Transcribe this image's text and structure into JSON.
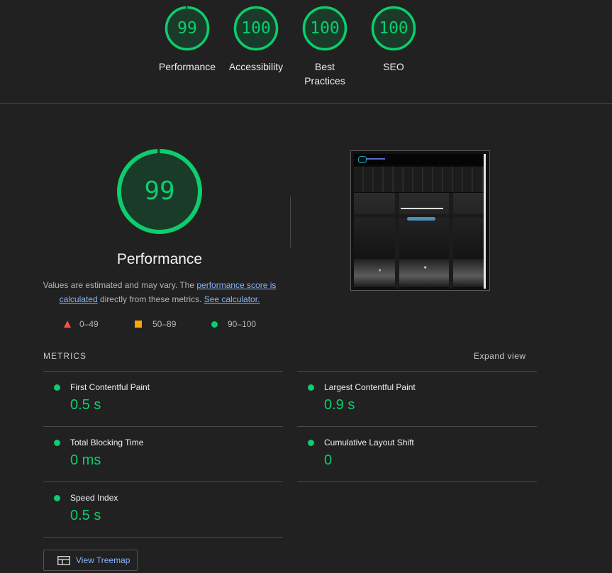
{
  "summary_gauges": [
    {
      "score": "99",
      "label": "Performance"
    },
    {
      "score": "100",
      "label": "Accessibility"
    },
    {
      "score": "100",
      "label": "Best Practices"
    },
    {
      "score": "100",
      "label": "SEO"
    }
  ],
  "performance": {
    "score": "99",
    "title": "Performance",
    "desc_prefix": "Values are estimated and may vary. The ",
    "desc_link1": "performance score is calculated",
    "desc_middle": " directly from these metrics. ",
    "desc_link2": "See calculator."
  },
  "legend": [
    {
      "range": "0–49",
      "icon": "red-triangle-icon"
    },
    {
      "range": "50–89",
      "icon": "orange-square-icon"
    },
    {
      "range": "90–100",
      "icon": "green-circle-icon"
    }
  ],
  "metrics_header": {
    "title": "METRICS",
    "expand_label": "Expand view"
  },
  "metrics": [
    {
      "name": "First Contentful Paint",
      "value": "0.5 s"
    },
    {
      "name": "Largest Contentful Paint",
      "value": "0.9 s"
    },
    {
      "name": "Total Blocking Time",
      "value": "0 ms"
    },
    {
      "name": "Cumulative Layout Shift",
      "value": "0"
    },
    {
      "name": "Speed Index",
      "value": "0.5 s"
    }
  ],
  "treemap_button": {
    "label": "View Treemap",
    "icon": "treemap-icon"
  },
  "colors": {
    "pass": "#0cce6b",
    "average": "#ffa400",
    "fail": "#ff4e42",
    "background": "#212121",
    "link": "#8ab4f8"
  }
}
